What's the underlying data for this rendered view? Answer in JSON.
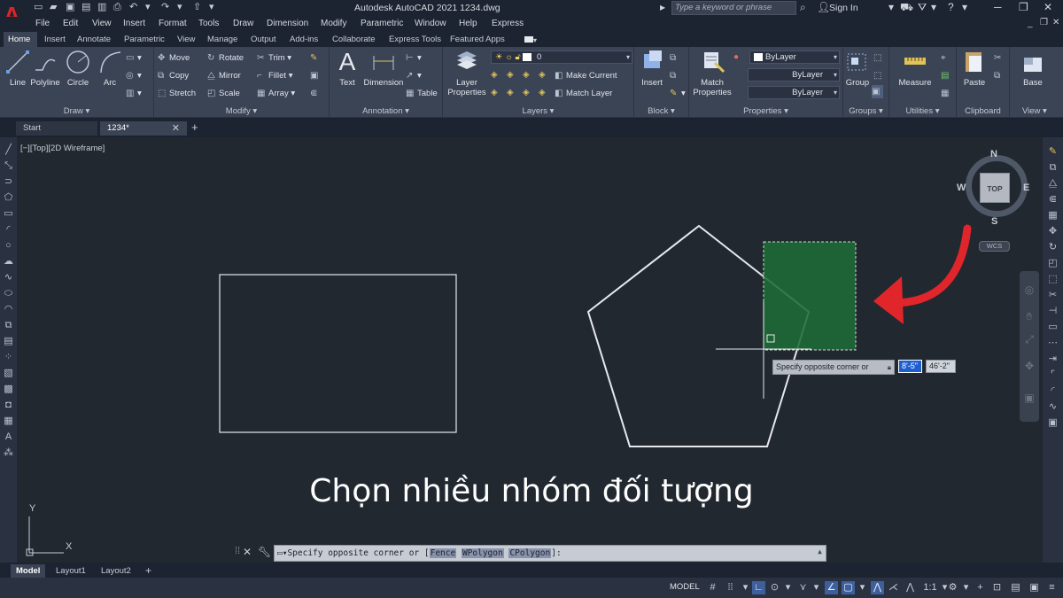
{
  "window": {
    "title": "Autodesk AutoCAD 2021    1234.dwg",
    "search_placeholder": "Type a keyword or phrase",
    "sign_in": "Sign In",
    "app_logo": "A"
  },
  "menu": [
    "File",
    "Edit",
    "View",
    "Insert",
    "Format",
    "Tools",
    "Draw",
    "Dimension",
    "Modify",
    "Parametric",
    "Window",
    "Help",
    "Express"
  ],
  "ribbon_tabs": [
    "Home",
    "Insert",
    "Annotate",
    "Parametric",
    "View",
    "Manage",
    "Output",
    "Add-ins",
    "Collaborate",
    "Express Tools",
    "Featured Apps"
  ],
  "ribbon": {
    "draw": {
      "title": "Draw",
      "line": "Line",
      "polyline": "Polyline",
      "circle": "Circle",
      "arc": "Arc"
    },
    "modify": {
      "title": "Modify",
      "move": "Move",
      "rotate": "Rotate",
      "trim": "Trim",
      "copy": "Copy",
      "mirror": "Mirror",
      "fillet": "Fillet",
      "stretch": "Stretch",
      "scale": "Scale",
      "array": "Array"
    },
    "annotation": {
      "title": "Annotation",
      "text": "Text",
      "dimension": "Dimension",
      "table": "Table"
    },
    "layers": {
      "title": "Layers",
      "layer_properties_1": "Layer",
      "layer_properties_2": "Properties",
      "current_layer": "0",
      "make_current": "Make Current",
      "match_layer": "Match Layer"
    },
    "block": {
      "title": "Block",
      "insert": "Insert"
    },
    "properties": {
      "title": "Properties",
      "match_1": "Match",
      "match_2": "Properties",
      "color": "ByLayer",
      "linetype": "ByLayer",
      "lineweight": "ByLayer"
    },
    "groups": {
      "title": "Groups",
      "group": "Group"
    },
    "utilities": {
      "title": "Utilities",
      "measure": "Measure"
    },
    "clipboard": {
      "title": "Clipboard",
      "paste": "Paste"
    },
    "view": {
      "title": "View",
      "base": "Base"
    }
  },
  "file_tabs": {
    "start": "Start",
    "drawing": "1234*"
  },
  "viewport": {
    "label": "[−][Top][2D Wireframe]",
    "viewcube": {
      "face": "TOP",
      "n": "N",
      "s": "S",
      "e": "E",
      "w": "W",
      "wcs": "WCS"
    },
    "ucs": {
      "x": "X",
      "y": "Y"
    }
  },
  "dynamic_input": {
    "prompt": "Specify opposite corner or",
    "value_1": "8'-5\"",
    "value_2": "46'-2\""
  },
  "caption": "Chọn nhiều nhóm đối tượng",
  "command_line": {
    "prefix": "Specify opposite corner or [",
    "opt1": "Fence",
    "opt2": "WPolygon",
    "opt3": "CPolygon",
    "suffix": "]:"
  },
  "layout_tabs": [
    "Model",
    "Layout1",
    "Layout2"
  ],
  "status": {
    "model": "MODEL",
    "scale": "1:1"
  },
  "colors": {
    "canvas": "#212830",
    "selection_fill": "#1e6b36",
    "arrow": "#e0262a",
    "accent": "#1e5fcf"
  }
}
